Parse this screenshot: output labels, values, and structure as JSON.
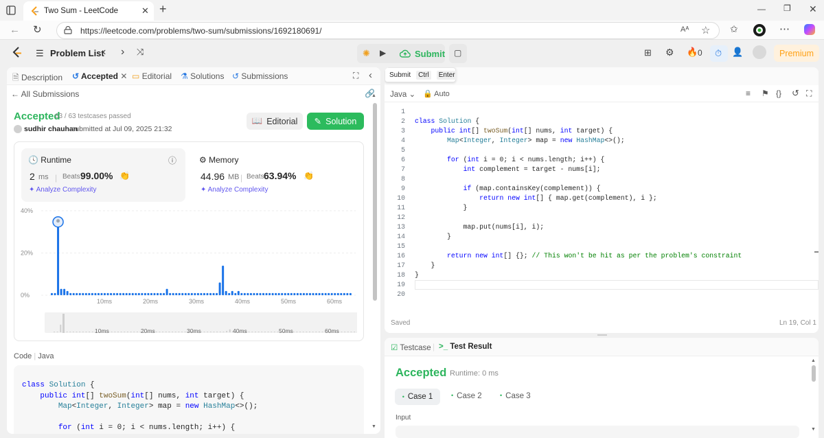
{
  "browser": {
    "tab_title": "Two Sum - LeetCode",
    "url": "https://leetcode.com/problems/two-sum/submissions/1692180691/"
  },
  "header": {
    "problem_list": "Problem List",
    "submit": "Submit",
    "streak_count": "0",
    "premium": "Premium"
  },
  "left": {
    "tabs": {
      "description": "Description",
      "accepted": "Accepted",
      "editorial": "Editorial",
      "solutions": "Solutions",
      "submissions": "Submissions"
    },
    "all_submissions": "All Submissions",
    "status": "Accepted",
    "testcases": "63 / 63 testcases passed",
    "user": "sudhir chauhan",
    "submitted_at": "submitted at Jul 09, 2025 21:32",
    "editorial_btn": "Editorial",
    "solution_btn": "Solution",
    "runtime": {
      "label": "Runtime",
      "value": "2",
      "unit": "ms",
      "beats_label": "Beats",
      "beats": "99.00%",
      "analyze": "Analyze Complexity"
    },
    "memory": {
      "label": "Memory",
      "value": "44.96",
      "unit": "MB",
      "beats_label": "Beats",
      "beats": "63.94%",
      "analyze": "Analyze Complexity"
    },
    "code_label": "Code",
    "code_lang": "Java",
    "code_preview": [
      "class Solution {",
      "    public int[] twoSum(int[] nums, int target) {",
      "        Map<Integer, Integer> map = new HashMap<>();",
      "",
      "        for (int i = 0; i < nums.length; i++) {"
    ]
  },
  "chart_data": {
    "type": "bar",
    "x_ticks": [
      "10ms",
      "20ms",
      "30ms",
      "40ms",
      "50ms",
      "60ms"
    ],
    "y_ticks": [
      "40%",
      "20%",
      "0%"
    ],
    "ylim": [
      0,
      40
    ],
    "values": [
      1,
      1,
      37,
      3,
      3,
      2,
      1,
      1,
      1,
      1,
      1,
      1,
      1,
      1,
      1,
      1,
      1,
      1,
      1,
      1,
      1,
      1,
      1,
      1,
      1,
      1,
      1,
      1,
      1,
      1,
      1,
      1,
      1,
      1,
      1,
      1,
      1,
      3,
      1,
      1,
      1,
      1,
      1,
      1,
      1,
      1,
      1,
      1,
      1,
      1,
      1,
      1,
      1,
      1,
      6,
      14,
      2,
      1,
      2,
      1,
      2,
      1,
      1,
      1,
      1,
      1,
      1,
      1,
      1,
      1,
      1,
      1,
      1,
      1,
      1,
      1,
      1,
      1,
      1,
      1,
      1,
      1,
      1,
      1,
      1,
      1,
      1,
      1,
      1,
      1,
      1,
      1,
      1,
      1,
      1,
      1,
      1
    ],
    "highlight_index": 2,
    "minimap_ticks": [
      "10ms",
      "20ms",
      "30ms",
      "40ms",
      "50ms",
      "60ms"
    ]
  },
  "editor": {
    "tooltip": {
      "submit": "Submit",
      "ctrl": "Ctrl",
      "enter": "Enter"
    },
    "lang": "Java",
    "mode": "Auto",
    "lines": [
      "",
      "class Solution {",
      "    public int[] twoSum(int[] nums, int target) {",
      "        Map<Integer, Integer> map = new HashMap<>();",
      "",
      "        for (int i = 0; i < nums.length; i++) {",
      "            int complement = target - nums[i];",
      "",
      "            if (map.containsKey(complement)) {",
      "                return new int[] { map.get(complement), i };",
      "            }",
      "",
      "            map.put(nums[i], i);",
      "        }",
      "",
      "        return new int[] {}; // This won't be hit as per the problem's constraint",
      "    }",
      "}",
      "",
      ""
    ],
    "status_saved": "Saved",
    "status_pos": "Ln 19, Col 1"
  },
  "bottom": {
    "tab_testcase": "Testcase",
    "tab_result": "Test Result",
    "result": "Accepted",
    "runtime": "Runtime: 0 ms",
    "cases": [
      "Case 1",
      "Case 2",
      "Case 3"
    ],
    "input_label": "Input"
  },
  "colors": {
    "accent_green": "#2cbb5d",
    "status_green": "#2db55d",
    "bar_blue": "#1a73e8",
    "premium": "#fff1dd"
  }
}
